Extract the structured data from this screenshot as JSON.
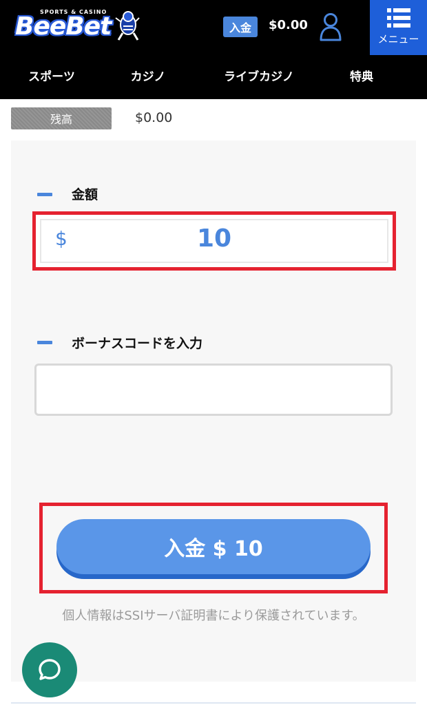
{
  "header": {
    "logo_text": "BeeBet",
    "logo_sub": "SPORTS & CASINO",
    "deposit_chip": "入金",
    "balance": "$0.00",
    "menu_label": "メニュー",
    "brand_color": "#1e5fd9"
  },
  "nav": {
    "items": [
      {
        "label": "スポーツ"
      },
      {
        "label": "カジノ"
      },
      {
        "label": "ライブカジノ"
      },
      {
        "label": "特典"
      }
    ]
  },
  "balance_row": {
    "label": "残高",
    "value": "$0.00"
  },
  "form": {
    "amount_title": "金額",
    "currency_symbol": "$",
    "amount_value": "10",
    "bonus_title": "ボーナスコードを入力",
    "bonus_value": "",
    "submit_label": "入金 $ 10",
    "ssl_note": "個人情報はSSIサーバ証明書により保護されています。",
    "accent_color": "#4a86dc",
    "highlight_color": "#e52230"
  },
  "chat": {
    "icon": "chat-bubble-icon",
    "color": "#1a8a76"
  }
}
